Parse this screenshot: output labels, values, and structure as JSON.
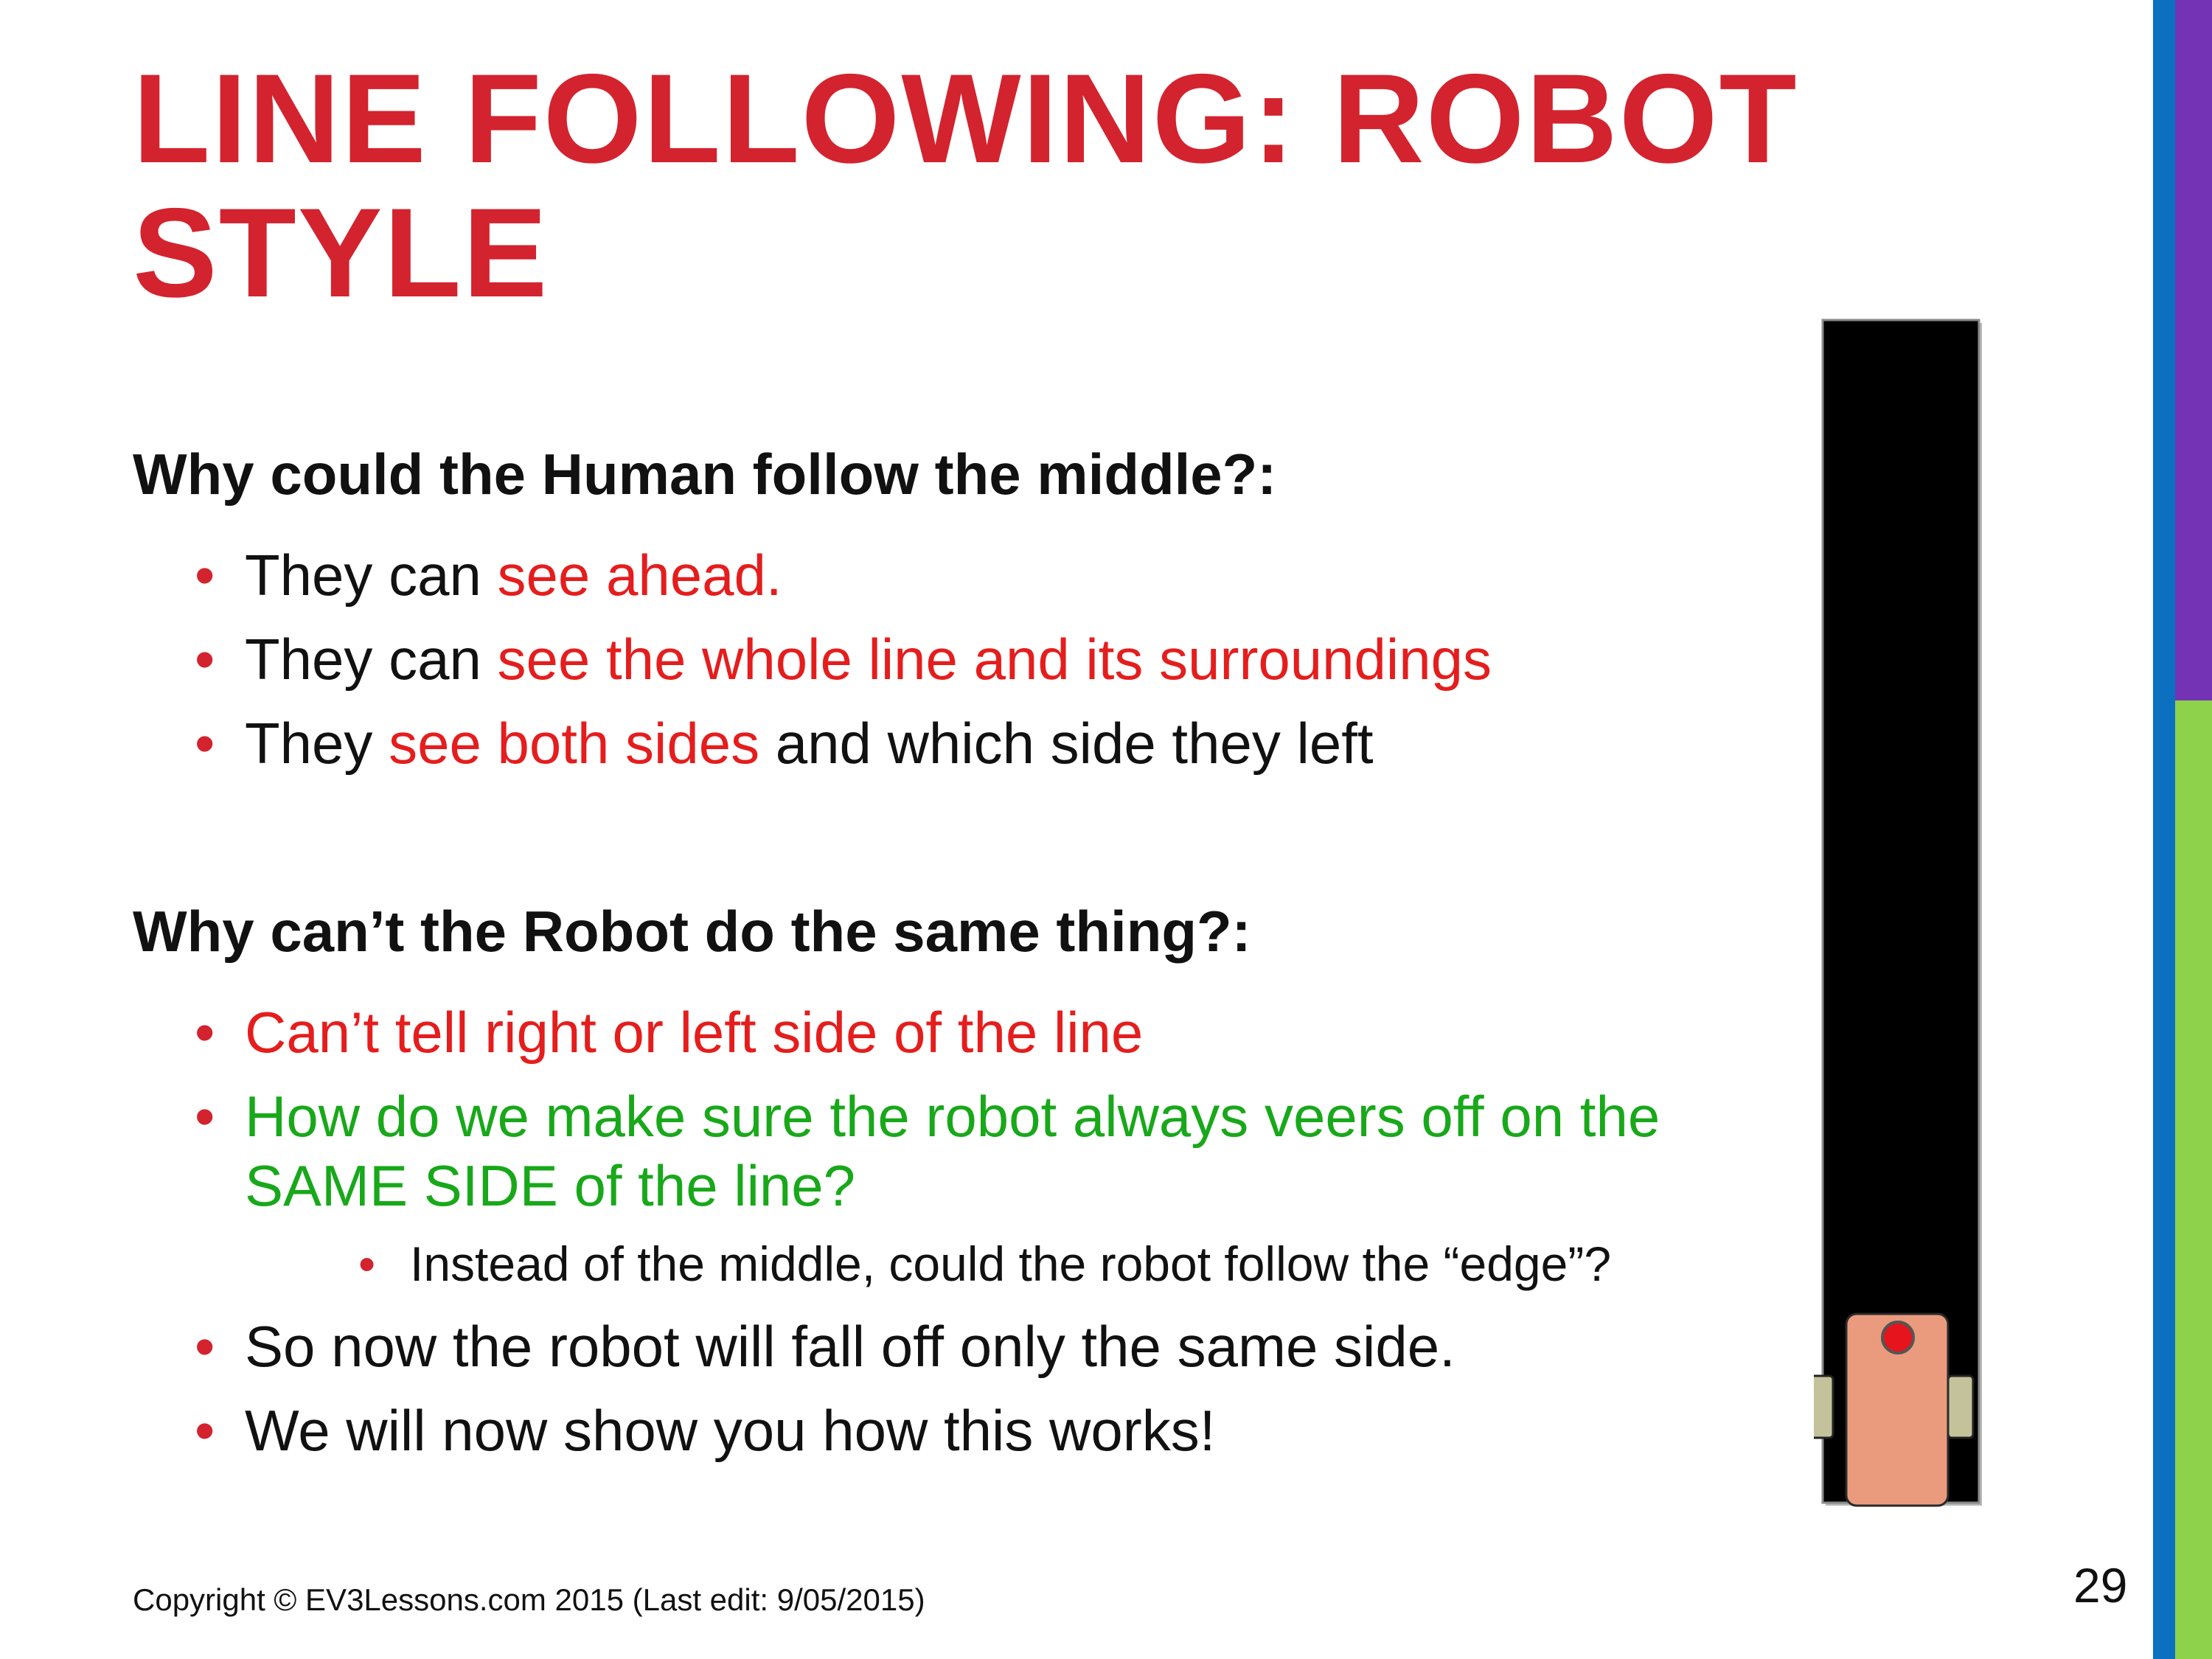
{
  "slide": {
    "title_line1": "LINE FOLLOWING: ROBOT",
    "title_line2": "STYLE",
    "section1": {
      "heading": "Why could the Human follow the middle?:",
      "bullets": [
        {
          "a": "They can ",
          "b": "see ahead.",
          "c": ""
        },
        {
          "a": "They can ",
          "b": "see the whole line and its surroundings",
          "c": ""
        },
        {
          "a": "They ",
          "b": "see both sides",
          "c": " and which side they left"
        }
      ]
    },
    "section2": {
      "heading": "Why can’t the Robot do the same thing?:",
      "bullet1": "Can’t tell right or left side of the line",
      "bullet2_line1": "How do we make sure the robot always veers off on the",
      "bullet2_line2": "SAME SIDE of the line?",
      "sub_bullet": "Instead of the middle, could the robot follow the “edge”?",
      "bullet3": "So now the robot will fall off only the same side.",
      "bullet4": "We will now show you how this works!"
    },
    "bullet_symbol": "•",
    "footer": "Copyright © EV3Lessons.com 2015 (Last edit: 9/05/2015)",
    "page_number": "29"
  },
  "colors": {
    "title": "#d3232e",
    "highlight_red": "#e51d1d",
    "highlight_green": "#18a81a",
    "bar_blue": "#0b70c0",
    "bar_purple": "#7433b4",
    "bar_lime": "#8ed14a",
    "robot_body": "#eb9b7d",
    "robot_sensor": "#e6141c",
    "robot_wheel": "#c4c29a"
  }
}
